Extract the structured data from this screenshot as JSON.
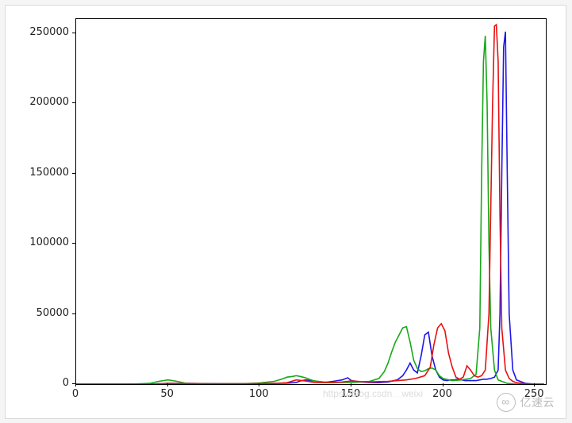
{
  "chart_data": {
    "type": "line",
    "xlabel": "",
    "ylabel": "",
    "title": "",
    "xlim": [
      0,
      256
    ],
    "ylim": [
      0,
      260000
    ],
    "xticks": [
      0,
      50,
      100,
      150,
      200,
      250
    ],
    "yticks": [
      0,
      50000,
      100000,
      150000,
      200000,
      250000
    ],
    "series": [
      {
        "name": "blue",
        "color": "#1f17e8",
        "x": [
          0,
          10,
          20,
          30,
          40,
          50,
          60,
          70,
          80,
          90,
          100,
          110,
          115,
          120,
          122,
          125,
          130,
          135,
          140,
          145,
          148,
          150,
          155,
          160,
          165,
          170,
          175,
          178,
          180,
          182,
          184,
          186,
          188,
          190,
          192,
          194,
          196,
          198,
          200,
          202,
          204,
          206,
          208,
          210,
          212,
          214,
          216,
          218,
          220,
          222,
          224,
          226,
          228,
          230,
          231,
          232,
          233,
          234,
          235,
          236,
          238,
          240,
          245,
          250,
          255
        ],
        "values": [
          0,
          0,
          0,
          0,
          0,
          500,
          500,
          400,
          300,
          300,
          300,
          500,
          700,
          1200,
          2200,
          3000,
          2200,
          1200,
          2000,
          3000,
          4500,
          2500,
          1500,
          1200,
          1000,
          1500,
          3000,
          6000,
          10000,
          15000,
          10000,
          8000,
          20000,
          35000,
          37000,
          20000,
          10000,
          5000,
          3000,
          2500,
          3000,
          3000,
          3500,
          3000,
          2500,
          2500,
          2500,
          2500,
          3000,
          3500,
          3500,
          4000,
          5000,
          10000,
          50000,
          150000,
          240000,
          251000,
          150000,
          50000,
          10000,
          3000,
          500,
          0,
          0
        ]
      },
      {
        "name": "green",
        "color": "#17a81a",
        "x": [
          0,
          10,
          20,
          30,
          40,
          45,
          50,
          55,
          60,
          70,
          80,
          90,
          100,
          108,
          112,
          115,
          118,
          120,
          122,
          125,
          128,
          130,
          135,
          140,
          145,
          150,
          155,
          160,
          165,
          168,
          170,
          172,
          174,
          176,
          178,
          180,
          182,
          184,
          186,
          188,
          190,
          192,
          194,
          196,
          198,
          200,
          205,
          210,
          215,
          218,
          220,
          221,
          222,
          223,
          224,
          225,
          226,
          228,
          230,
          235,
          240,
          245,
          250,
          255
        ],
        "values": [
          0,
          0,
          0,
          0,
          500,
          2000,
          3000,
          2000,
          500,
          300,
          300,
          300,
          800,
          2000,
          3500,
          5000,
          5500,
          6000,
          5500,
          4500,
          3000,
          2200,
          1500,
          1200,
          1200,
          1200,
          1500,
          2000,
          4000,
          9000,
          15000,
          23000,
          30000,
          35000,
          40000,
          41000,
          30000,
          17000,
          11000,
          9000,
          9500,
          11000,
          11500,
          10000,
          6000,
          4000,
          2500,
          3000,
          4000,
          7000,
          40000,
          150000,
          230000,
          248000,
          200000,
          100000,
          40000,
          10000,
          3000,
          500,
          0,
          0,
          0,
          0
        ]
      },
      {
        "name": "red",
        "color": "#e81010",
        "x": [
          0,
          10,
          20,
          30,
          40,
          50,
          60,
          70,
          80,
          90,
          100,
          110,
          115,
          120,
          125,
          130,
          135,
          140,
          145,
          150,
          155,
          160,
          165,
          170,
          175,
          180,
          185,
          190,
          193,
          195,
          197,
          199,
          201,
          203,
          205,
          207,
          209,
          211,
          213,
          215,
          217,
          219,
          221,
          223,
          225,
          227,
          228,
          229,
          230,
          231,
          232,
          234,
          236,
          238,
          240,
          245,
          250,
          255
        ],
        "values": [
          0,
          0,
          0,
          0,
          0,
          500,
          400,
          300,
          300,
          300,
          400,
          600,
          1000,
          3000,
          2200,
          1200,
          1000,
          1000,
          1500,
          2200,
          1800,
          1600,
          1800,
          2000,
          2500,
          3000,
          4000,
          6000,
          12000,
          28000,
          40000,
          43000,
          38000,
          22000,
          12000,
          5000,
          3500,
          5000,
          13000,
          10000,
          6000,
          5000,
          6000,
          10000,
          50000,
          200000,
          255000,
          256000,
          230000,
          120000,
          40000,
          10000,
          4000,
          2000,
          1000,
          300,
          0,
          0
        ]
      }
    ]
  },
  "watermark": {
    "text1": "https://blog.csdn",
    "text2": "weixi",
    "brand": "亿速云"
  }
}
